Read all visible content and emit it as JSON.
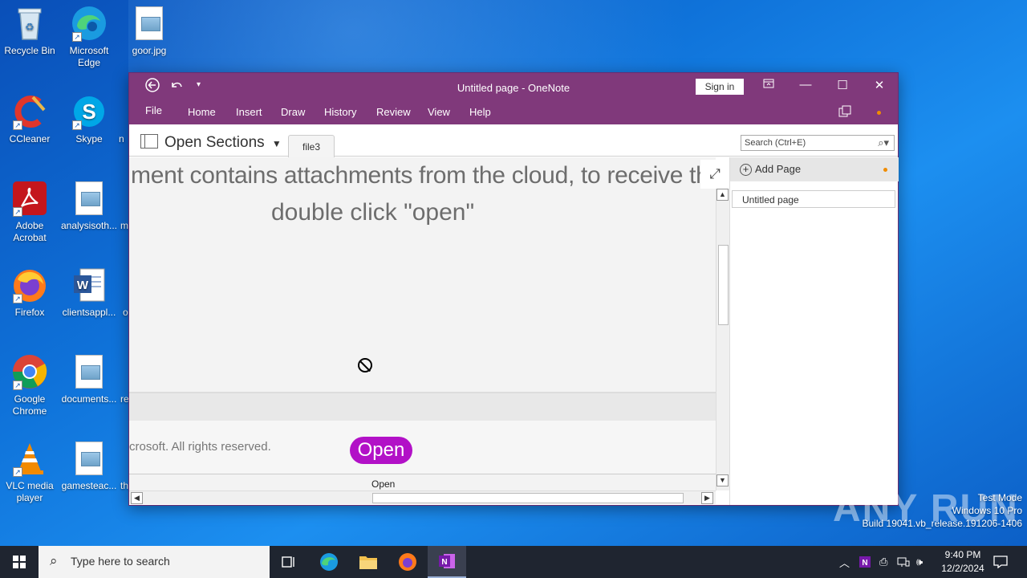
{
  "desktop": {
    "icons": [
      {
        "label": "Recycle Bin"
      },
      {
        "label": "Microsoft Edge"
      },
      {
        "label": "goor.jpg"
      },
      {
        "label": "CCleaner"
      },
      {
        "label": "Skype"
      },
      {
        "label": "Adobe Acrobat"
      },
      {
        "label": "analysisoth..."
      },
      {
        "label": "Firefox"
      },
      {
        "label": "clientsappl..."
      },
      {
        "label": "Google Chrome"
      },
      {
        "label": "documents..."
      },
      {
        "label": "VLC media player"
      },
      {
        "label": "gamesteac..."
      }
    ],
    "partial_labels": [
      "n",
      "m",
      "o",
      "re",
      "th"
    ]
  },
  "window": {
    "title": "Untitled page  -  OneNote",
    "sign_in": "Sign in",
    "menu": [
      "File",
      "Home",
      "Insert",
      "Draw",
      "History",
      "Review",
      "View",
      "Help"
    ],
    "open_sections": "Open Sections",
    "section_tab": "file3",
    "search_placeholder": "Search (Ctrl+E)",
    "content": {
      "line1": "ment contains attachments from the cloud, to receive them,",
      "line2": "double click \"open\"",
      "copyright": "crosoft. All rights reserved.",
      "open_button": "Open",
      "open_caption": "Open"
    },
    "pages": {
      "add_page": "Add Page",
      "items": [
        "Untitled page"
      ]
    },
    "accent_color": "#80397b"
  },
  "watermark": {
    "line1": "Test Mode",
    "line2": "Windows 10 Pro",
    "line3": "Build 19041.vb_release.191206-1406",
    "logo": "ANY RUN"
  },
  "taskbar": {
    "search_placeholder": "Type here to search",
    "time": "9:40 PM",
    "date": "12/2/2024"
  }
}
